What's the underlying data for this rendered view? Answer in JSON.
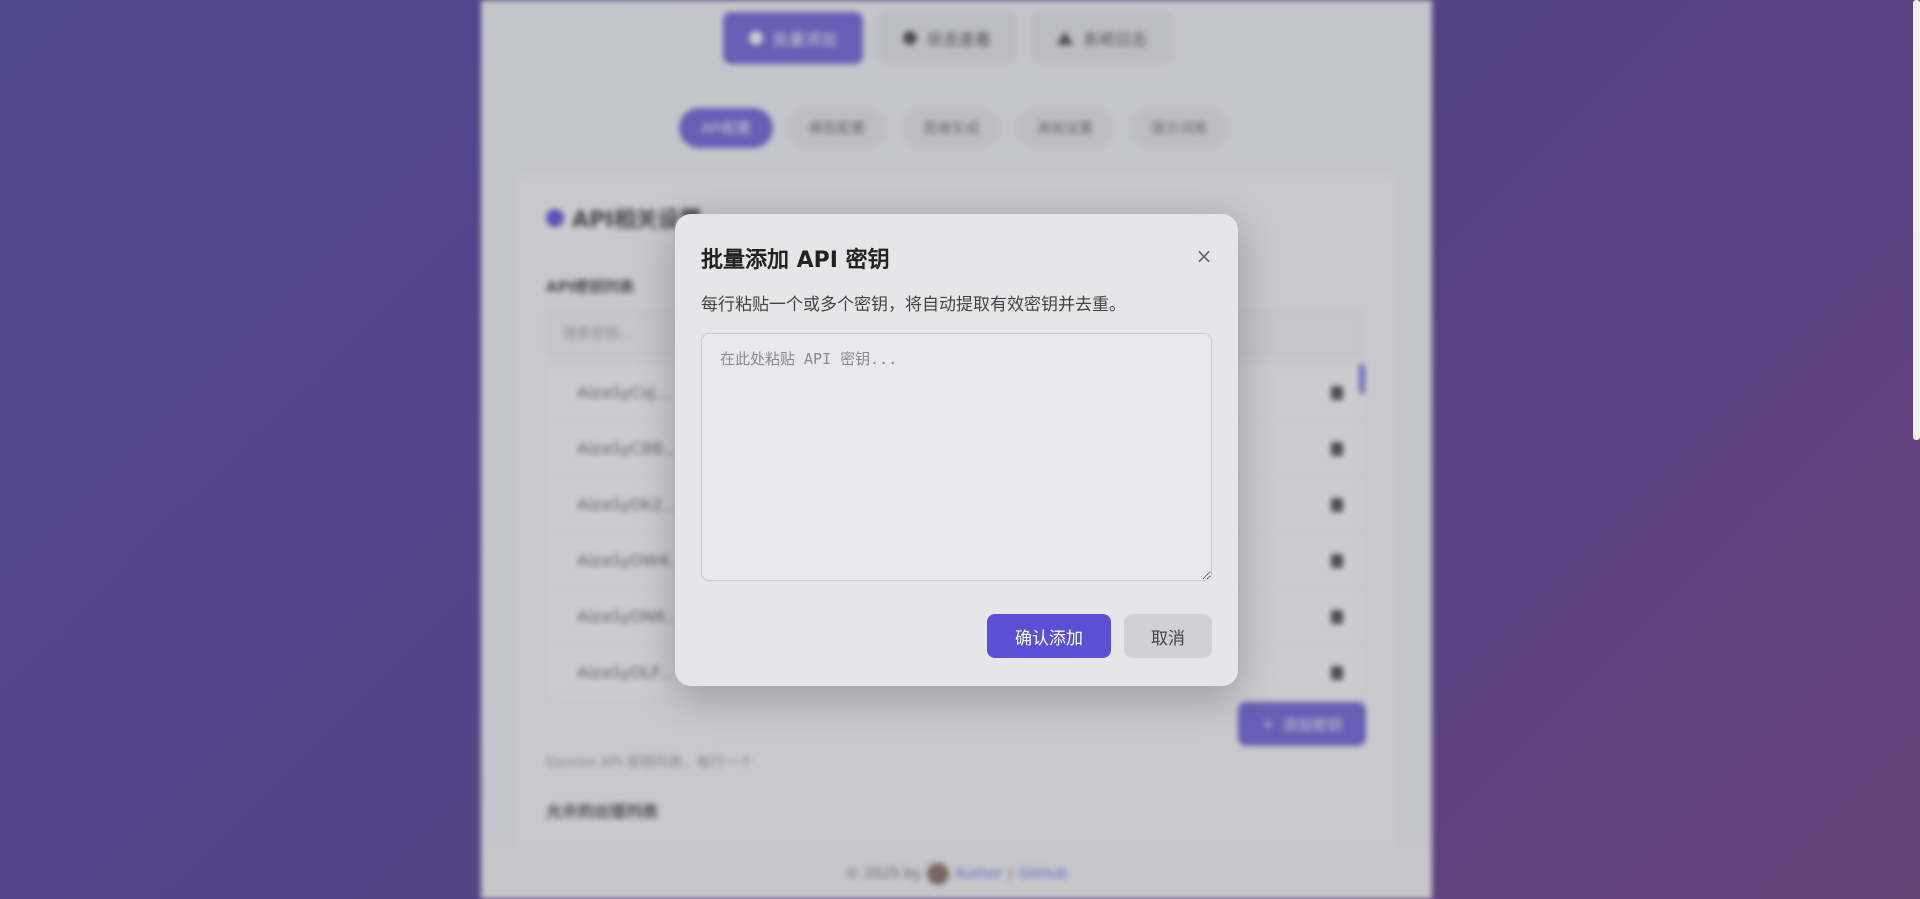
{
  "background": {
    "top_tabs": [
      {
        "label": "批量添加"
      },
      {
        "label": "状态查看"
      },
      {
        "label": "系统日志"
      }
    ],
    "sub_tabs": [
      {
        "label": "API配置"
      },
      {
        "label": "模型配置"
      },
      {
        "label": "思维生成"
      },
      {
        "label": "高级设置"
      },
      {
        "label": "提示词库"
      }
    ],
    "card": {
      "title": "API相关设置",
      "list_label": "API密钥列表",
      "search_placeholder": "搜索密钥...",
      "keys": [
        "AIzaSyCsJ...",
        "AIzaSyC8B...",
        "AIzaSyDk2...",
        "AIzaSyDW4...",
        "AIzaSyDN8...",
        "AIzaSyDLF..."
      ],
      "add_key_label": "添加密钥",
      "hint": "Gemini API 密钥列表，每行一个",
      "section2_title": "允许的出错列表"
    },
    "footer": {
      "text": "© 2025 by",
      "author": "Author",
      "link": "GitHub"
    }
  },
  "modal": {
    "title": "批量添加 API 密钥",
    "close_symbol": "×",
    "description": "每行粘贴一个或多个密钥，将自动提取有效密钥并去重。",
    "textarea_placeholder": "在此处粘贴 API 密钥...",
    "textarea_value": "",
    "confirm_label": "确认添加",
    "cancel_label": "取消"
  },
  "colors": {
    "accent": "#5b4fd6",
    "modal_bg": "#e6e6e8",
    "cancel_bg": "#d1d1d5"
  }
}
